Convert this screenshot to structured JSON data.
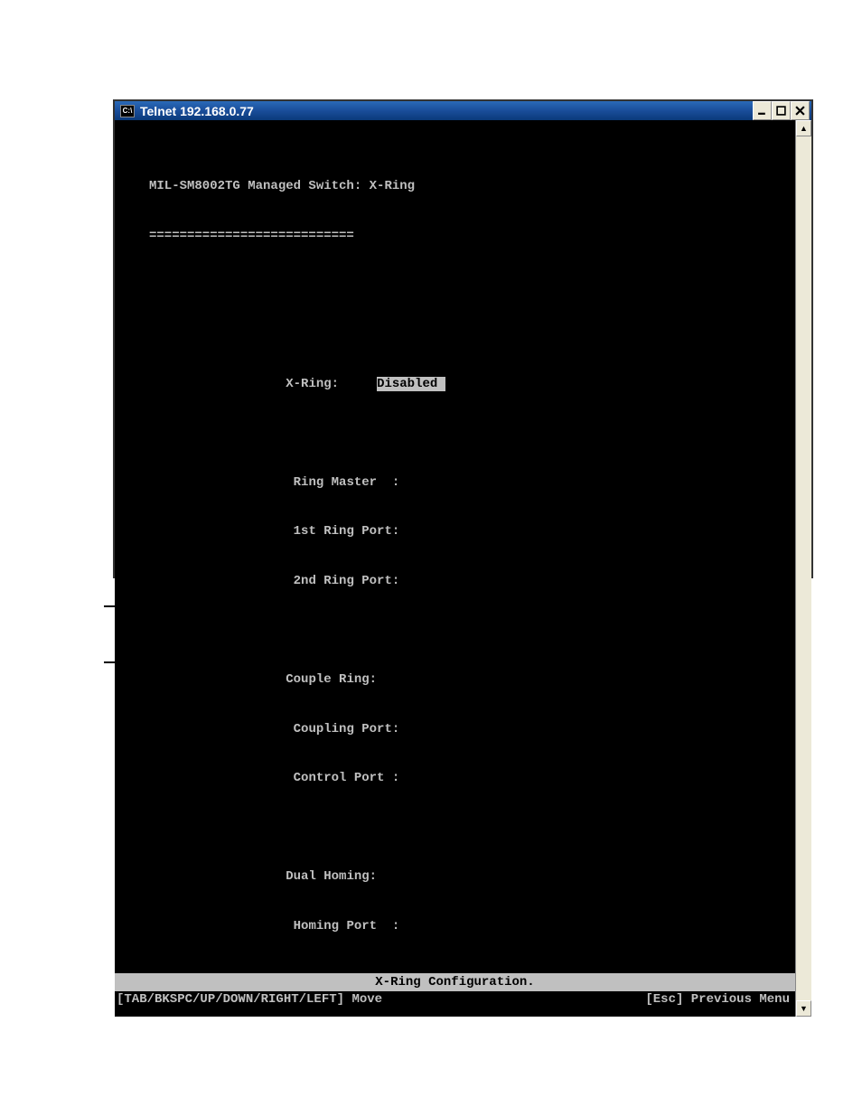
{
  "window": {
    "icon_text": "C:\\",
    "title": "Telnet 192.168.0.77"
  },
  "terminal": {
    "header": "MIL-SM8002TG Managed Switch: X-Ring",
    "divider": "===========================",
    "fields": {
      "xring_label": "X-Ring:",
      "xring_value": "Disabled ",
      "ring_master_label": "Ring Master  :",
      "first_ring_port_label": "1st Ring Port:",
      "second_ring_port_label": "2nd Ring Port:",
      "couple_ring_label": "Couple Ring:",
      "coupling_port_label": "Coupling Port:",
      "control_port_label": "Control Port :",
      "dual_homing_label": "Dual Homing:",
      "homing_port_label": "Homing Port  :"
    },
    "status_hint": "X-Ring Configuration.",
    "nav_left": "[TAB/BKSPC/UP/DOWN/RIGHT/LEFT] Move",
    "nav_right": "[Esc] Previous Menu"
  }
}
